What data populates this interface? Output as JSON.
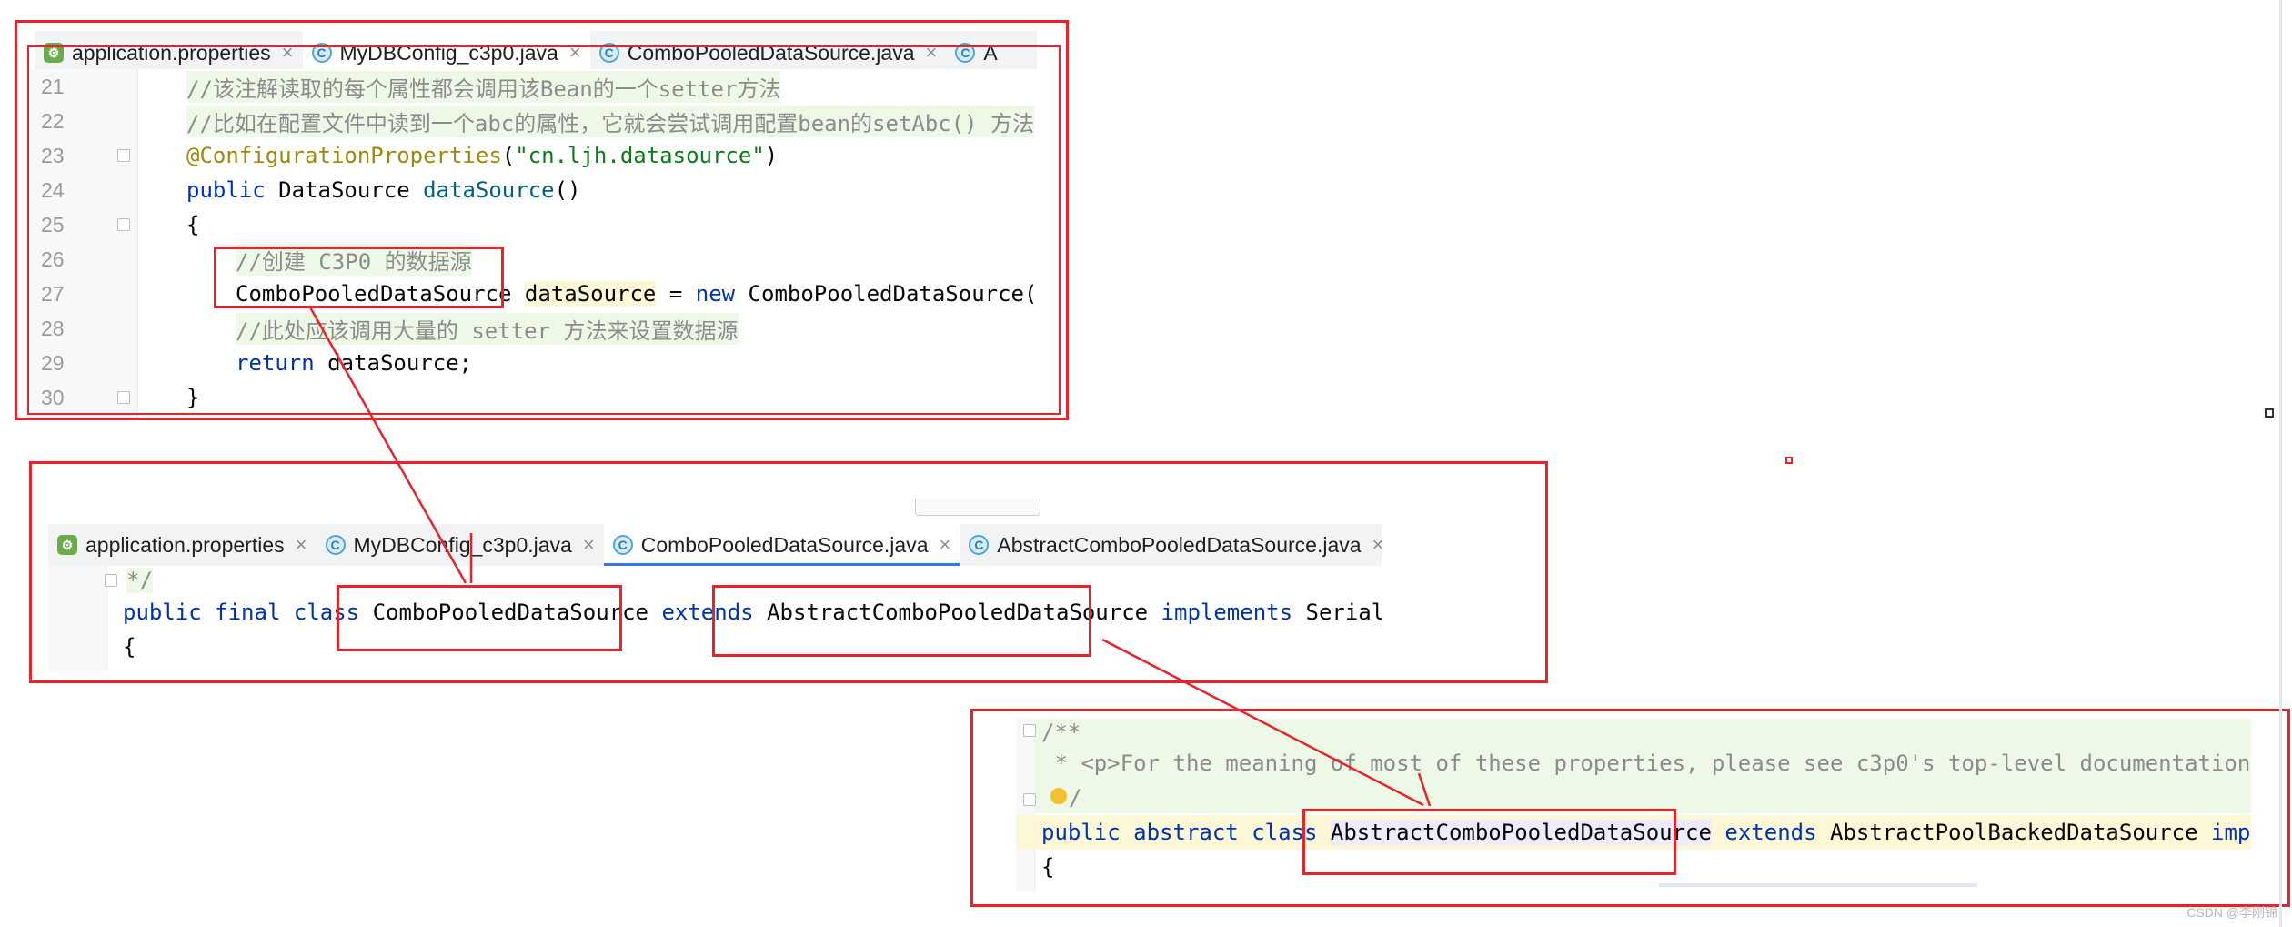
{
  "panel1": {
    "tabs": [
      {
        "label": "application.properties",
        "icon": "properties-file-icon",
        "active": false
      },
      {
        "label": "MyDBConfig_c3p0.java",
        "icon": "java-class-icon",
        "active": true
      },
      {
        "label": "ComboPooledDataSource.java",
        "icon": "java-class-icon",
        "active": false
      },
      {
        "label": "A",
        "icon": "java-class-icon",
        "active": false
      }
    ],
    "line_numbers": [
      "21",
      "22",
      "23",
      "24",
      "25",
      "26",
      "27",
      "28",
      "29",
      "30"
    ],
    "lines": {
      "l21": "//该注解读取的每个属性都会调用该Bean的一个setter方法",
      "l22": "//比如在配置文件中读到一个abc的属性，它就会尝试调用配置bean的setAbc() 方法",
      "l23_ann": "@ConfigurationProperties",
      "l23_open": "(",
      "l23_str": "\"cn.ljh.datasource\"",
      "l23_close": ")",
      "l24_kw": "public",
      "l24_type": " DataSource ",
      "l24_method": "dataSource",
      "l24_paren": "()",
      "l25": "{",
      "l26": "//创建 C3P0 的数据源",
      "l27_type": "ComboPooledDataSource",
      "l27_var": "dataSource",
      "l27_eq": " = ",
      "l27_new": "new",
      "l27_ctor": " ComboPooledDataSource();",
      "l28": "//此处应该调用大量的 setter 方法来设置数据源",
      "l29_kw": "return",
      "l29_rest": " dataSource;",
      "l30": "}"
    }
  },
  "panel2": {
    "tabs": [
      {
        "label": "application.properties",
        "icon": "properties-file-icon",
        "active": false
      },
      {
        "label": "MyDBConfig_c3p0.java",
        "icon": "java-class-icon",
        "active": false
      },
      {
        "label": "ComboPooledDataSource.java",
        "icon": "java-class-icon",
        "active": true
      },
      {
        "label": "AbstractComboPooledDataSource.java",
        "icon": "java-class-icon",
        "active": false
      }
    ],
    "lines": {
      "c1": "*/",
      "d_public": "public",
      "d_final": "final",
      "d_class": "class",
      "d_name": "ComboPooledDataSource",
      "d_extends": "extends",
      "d_parent": "AbstractComboPooledDataSource",
      "d_implements": "implements",
      "d_iface": "Serializable",
      "brace": "{"
    }
  },
  "panel3": {
    "lines": {
      "j1": "/**",
      "j2": " * <p>For the meaning of most of these properties, please see c3p0's top-level documentation!</p>",
      "j3": "/",
      "d_public": "public",
      "d_abstract": "abstract",
      "d_class": "class",
      "d_name": "AbstractComboPooledDataSource",
      "d_extends": "extends",
      "d_parent": "AbstractPoolBackedDataSource",
      "d_implement": "implement",
      "brace": "{"
    }
  },
  "watermark": "CSDN @李刚锦",
  "colors": {
    "annotation_red": "#e8232a",
    "active_tab_underline": "#3574f0",
    "keyword": "#0033b3",
    "string": "#067d17",
    "comment": "#8c8c8c"
  }
}
